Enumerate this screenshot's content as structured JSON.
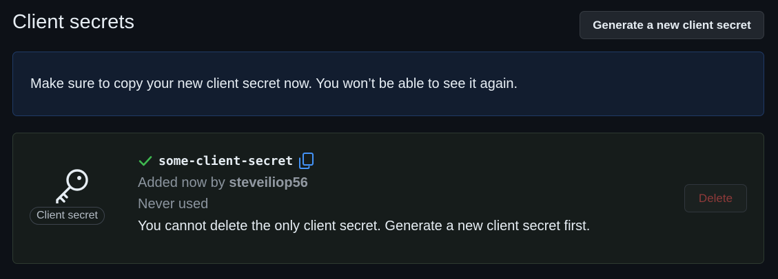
{
  "header": {
    "title": "Client secrets",
    "generate_button_label": "Generate a new client secret"
  },
  "flash": {
    "message": "Make sure to copy your new client secret now. You won’t be able to see it again."
  },
  "secret": {
    "icon": "key-icon",
    "badge_label": "Client secret",
    "status_icon": "check-icon",
    "name": "some-client-secret",
    "copy_icon": "copy-icon",
    "added_prefix": "Added now by",
    "added_by": "steveiliop56",
    "usage": "Never used",
    "warning": "You cannot delete the only client secret. Generate a new client secret first.",
    "delete_label": "Delete"
  },
  "colors": {
    "background": "#0d1117",
    "flash_bg": "#121d2f",
    "flash_border": "#1f3a66",
    "secret_bg": "#161c1b",
    "check": "#3fb950",
    "copy": "#4493f8",
    "delete_text": "#8f3a3a"
  }
}
